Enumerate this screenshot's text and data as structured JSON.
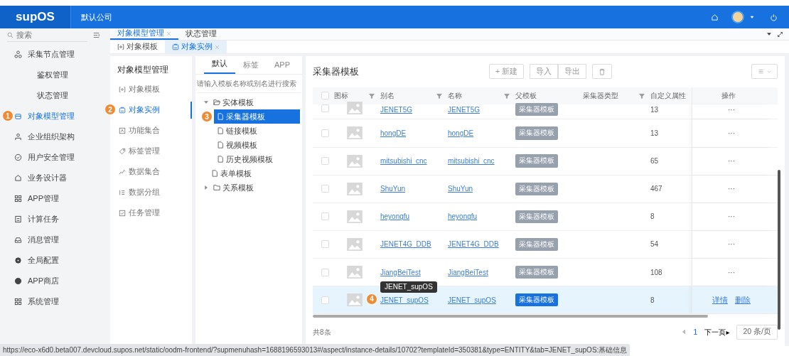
{
  "topbar": {
    "logo": "supOS",
    "company": "默认公司"
  },
  "sidebar": {
    "search_placeholder": "搜索",
    "items": [
      {
        "label": "采集节点管理",
        "selected": false,
        "children": [
          {
            "label": "鉴权管理",
            "selected": false
          },
          {
            "label": "状态管理",
            "selected": false
          }
        ]
      },
      {
        "label": "对象模型管理",
        "selected": true,
        "callout": "1"
      },
      {
        "label": "企业组织架构",
        "selected": false
      },
      {
        "label": "用户安全管理",
        "selected": false
      },
      {
        "label": "业务设计器",
        "selected": false
      },
      {
        "label": "APP管理",
        "selected": false
      },
      {
        "label": "计算任务",
        "selected": false
      },
      {
        "label": "消息管理",
        "selected": false
      },
      {
        "label": "全局配置",
        "selected": false
      },
      {
        "label": "APP商店",
        "selected": false
      },
      {
        "label": "系统管理",
        "selected": false
      }
    ]
  },
  "tabs": [
    {
      "label": "对象模型管理",
      "selected": true,
      "closable": true
    },
    {
      "label": "状态管理",
      "selected": false,
      "closable": false
    }
  ],
  "subtabs": [
    {
      "label": "对象模板",
      "selected": false,
      "closable": false
    },
    {
      "label": "对象实例",
      "selected": true,
      "closable": true
    }
  ],
  "module_menu": {
    "title": "对象模型管理",
    "items": [
      {
        "label": "对象模板",
        "selected": false
      },
      {
        "label": "对象实例",
        "selected": true,
        "callout": "2"
      },
      {
        "label": "功能集合",
        "selected": false
      },
      {
        "label": "标签管理",
        "selected": false
      },
      {
        "label": "数据集合",
        "selected": false
      },
      {
        "label": "数据分组",
        "selected": false
      },
      {
        "label": "任务管理",
        "selected": false
      }
    ]
  },
  "tree_panel": {
    "tabs": [
      {
        "label": "默认",
        "selected": true
      },
      {
        "label": "标签",
        "selected": false
      },
      {
        "label": "APP",
        "selected": false
      }
    ],
    "search": {
      "placeholder": "请输入模板名称或别名进行搜索"
    },
    "tree": [
      {
        "label": "实体模板",
        "kind": "folder",
        "expanded": true,
        "selected": false,
        "children": [
          {
            "label": "采集器模板",
            "kind": "file",
            "selected": true,
            "callout": "3"
          },
          {
            "label": "链接模板",
            "kind": "file",
            "selected": false
          },
          {
            "label": "视频模板",
            "kind": "file",
            "selected": false
          },
          {
            "label": "历史视频模板",
            "kind": "file",
            "selected": false
          }
        ]
      },
      {
        "label": "表单模板",
        "kind": "file",
        "selected": false
      },
      {
        "label": "关系模板",
        "kind": "folder",
        "expanded": false,
        "selected": false
      }
    ]
  },
  "table_panel": {
    "title": "采集器模板",
    "toolbar": [
      "+ 新建",
      "导入",
      "导出"
    ],
    "all_checked": false,
    "columns": [
      {
        "label": "图标",
        "filter": true
      },
      {
        "label": "别名",
        "filter": true
      },
      {
        "label": "名称",
        "filter": true
      },
      {
        "label": "父模板",
        "filter": false
      },
      {
        "label": "采集器类型",
        "filter": true
      },
      {
        "label": "自定义属性",
        "filter": false
      },
      {
        "label": "操作",
        "filter": false
      }
    ],
    "rows": [
      {
        "alias": "JENET5G",
        "name": "JENET5G",
        "parent": "采集器模板",
        "count": "13",
        "checked": false,
        "selected": false,
        "actions": [
          "···"
        ]
      },
      {
        "alias": "hongDE",
        "name": "hongDE",
        "parent": "采集器模板",
        "count": "13",
        "checked": false,
        "selected": false,
        "actions": [
          "···"
        ]
      },
      {
        "alias": "mitsubishi_cnc",
        "name": "mitsubishi_cnc",
        "parent": "采集器模板",
        "count": "65",
        "checked": false,
        "selected": false,
        "actions": [
          "···"
        ]
      },
      {
        "alias": "ShuYun",
        "name": "ShuYun",
        "parent": "采集器模板",
        "count": "467",
        "checked": false,
        "selected": false,
        "actions": [
          "···"
        ]
      },
      {
        "alias": "heyongfu",
        "name": "heyongfu",
        "parent": "采集器模板",
        "count": "8",
        "checked": false,
        "selected": false,
        "actions": [
          "···"
        ]
      },
      {
        "alias": "JENET4G_DDB",
        "name": "JENET4G_DDB",
        "parent": "采集器模板",
        "count": "54",
        "checked": false,
        "selected": false,
        "actions": [
          "···"
        ]
      },
      {
        "alias": "JiangBeiTest",
        "name": "JiangBeiTest",
        "parent": "采集器模板",
        "count": "108",
        "checked": false,
        "selected": false,
        "actions": [
          "···"
        ]
      },
      {
        "alias": "JENET_supOS",
        "name": "JENET_supOS",
        "parent": "采集器模板",
        "count": "8",
        "checked": false,
        "selected": true,
        "actions": [
          "详情",
          "删除"
        ],
        "tooltip": "JENET_supOS",
        "callout": "4"
      }
    ],
    "total": "共8条",
    "page": "1",
    "next": "下一页▸",
    "page_size": "20 条/页"
  },
  "status_url": "https://eco-x6d0.beta007.devcloud.supos.net/static/oodm-frontend/?supmenuhash=1688196593013#/aspect/instance-details/10702?templateId=350381&type=ENTITY&tab=JENET_supOS:基础信息"
}
